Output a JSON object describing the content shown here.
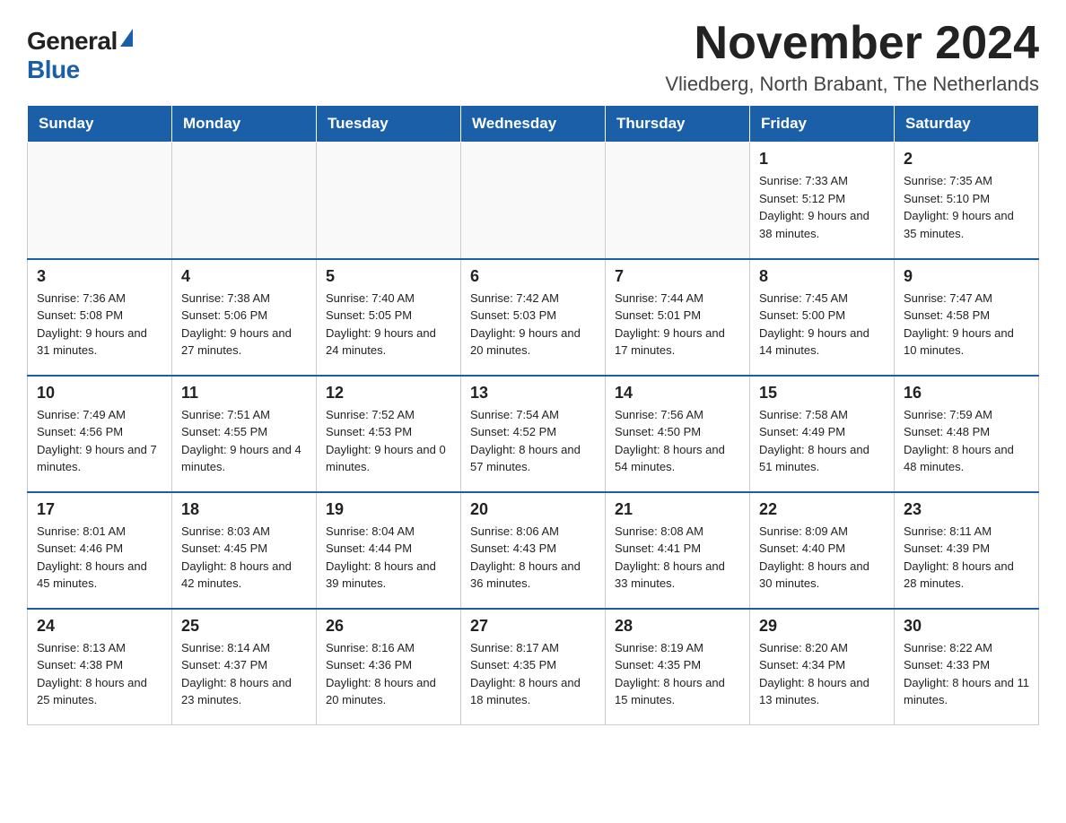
{
  "logo": {
    "general": "General",
    "blue": "Blue"
  },
  "title": {
    "month": "November 2024",
    "location": "Vliedberg, North Brabant, The Netherlands"
  },
  "weekdays": [
    "Sunday",
    "Monday",
    "Tuesday",
    "Wednesday",
    "Thursday",
    "Friday",
    "Saturday"
  ],
  "weeks": [
    [
      {
        "day": "",
        "info": ""
      },
      {
        "day": "",
        "info": ""
      },
      {
        "day": "",
        "info": ""
      },
      {
        "day": "",
        "info": ""
      },
      {
        "day": "",
        "info": ""
      },
      {
        "day": "1",
        "info": "Sunrise: 7:33 AM\nSunset: 5:12 PM\nDaylight: 9 hours and 38 minutes."
      },
      {
        "day": "2",
        "info": "Sunrise: 7:35 AM\nSunset: 5:10 PM\nDaylight: 9 hours and 35 minutes."
      }
    ],
    [
      {
        "day": "3",
        "info": "Sunrise: 7:36 AM\nSunset: 5:08 PM\nDaylight: 9 hours and 31 minutes."
      },
      {
        "day": "4",
        "info": "Sunrise: 7:38 AM\nSunset: 5:06 PM\nDaylight: 9 hours and 27 minutes."
      },
      {
        "day": "5",
        "info": "Sunrise: 7:40 AM\nSunset: 5:05 PM\nDaylight: 9 hours and 24 minutes."
      },
      {
        "day": "6",
        "info": "Sunrise: 7:42 AM\nSunset: 5:03 PM\nDaylight: 9 hours and 20 minutes."
      },
      {
        "day": "7",
        "info": "Sunrise: 7:44 AM\nSunset: 5:01 PM\nDaylight: 9 hours and 17 minutes."
      },
      {
        "day": "8",
        "info": "Sunrise: 7:45 AM\nSunset: 5:00 PM\nDaylight: 9 hours and 14 minutes."
      },
      {
        "day": "9",
        "info": "Sunrise: 7:47 AM\nSunset: 4:58 PM\nDaylight: 9 hours and 10 minutes."
      }
    ],
    [
      {
        "day": "10",
        "info": "Sunrise: 7:49 AM\nSunset: 4:56 PM\nDaylight: 9 hours and 7 minutes."
      },
      {
        "day": "11",
        "info": "Sunrise: 7:51 AM\nSunset: 4:55 PM\nDaylight: 9 hours and 4 minutes."
      },
      {
        "day": "12",
        "info": "Sunrise: 7:52 AM\nSunset: 4:53 PM\nDaylight: 9 hours and 0 minutes."
      },
      {
        "day": "13",
        "info": "Sunrise: 7:54 AM\nSunset: 4:52 PM\nDaylight: 8 hours and 57 minutes."
      },
      {
        "day": "14",
        "info": "Sunrise: 7:56 AM\nSunset: 4:50 PM\nDaylight: 8 hours and 54 minutes."
      },
      {
        "day": "15",
        "info": "Sunrise: 7:58 AM\nSunset: 4:49 PM\nDaylight: 8 hours and 51 minutes."
      },
      {
        "day": "16",
        "info": "Sunrise: 7:59 AM\nSunset: 4:48 PM\nDaylight: 8 hours and 48 minutes."
      }
    ],
    [
      {
        "day": "17",
        "info": "Sunrise: 8:01 AM\nSunset: 4:46 PM\nDaylight: 8 hours and 45 minutes."
      },
      {
        "day": "18",
        "info": "Sunrise: 8:03 AM\nSunset: 4:45 PM\nDaylight: 8 hours and 42 minutes."
      },
      {
        "day": "19",
        "info": "Sunrise: 8:04 AM\nSunset: 4:44 PM\nDaylight: 8 hours and 39 minutes."
      },
      {
        "day": "20",
        "info": "Sunrise: 8:06 AM\nSunset: 4:43 PM\nDaylight: 8 hours and 36 minutes."
      },
      {
        "day": "21",
        "info": "Sunrise: 8:08 AM\nSunset: 4:41 PM\nDaylight: 8 hours and 33 minutes."
      },
      {
        "day": "22",
        "info": "Sunrise: 8:09 AM\nSunset: 4:40 PM\nDaylight: 8 hours and 30 minutes."
      },
      {
        "day": "23",
        "info": "Sunrise: 8:11 AM\nSunset: 4:39 PM\nDaylight: 8 hours and 28 minutes."
      }
    ],
    [
      {
        "day": "24",
        "info": "Sunrise: 8:13 AM\nSunset: 4:38 PM\nDaylight: 8 hours and 25 minutes."
      },
      {
        "day": "25",
        "info": "Sunrise: 8:14 AM\nSunset: 4:37 PM\nDaylight: 8 hours and 23 minutes."
      },
      {
        "day": "26",
        "info": "Sunrise: 8:16 AM\nSunset: 4:36 PM\nDaylight: 8 hours and 20 minutes."
      },
      {
        "day": "27",
        "info": "Sunrise: 8:17 AM\nSunset: 4:35 PM\nDaylight: 8 hours and 18 minutes."
      },
      {
        "day": "28",
        "info": "Sunrise: 8:19 AM\nSunset: 4:35 PM\nDaylight: 8 hours and 15 minutes."
      },
      {
        "day": "29",
        "info": "Sunrise: 8:20 AM\nSunset: 4:34 PM\nDaylight: 8 hours and 13 minutes."
      },
      {
        "day": "30",
        "info": "Sunrise: 8:22 AM\nSunset: 4:33 PM\nDaylight: 8 hours and 11 minutes."
      }
    ]
  ]
}
